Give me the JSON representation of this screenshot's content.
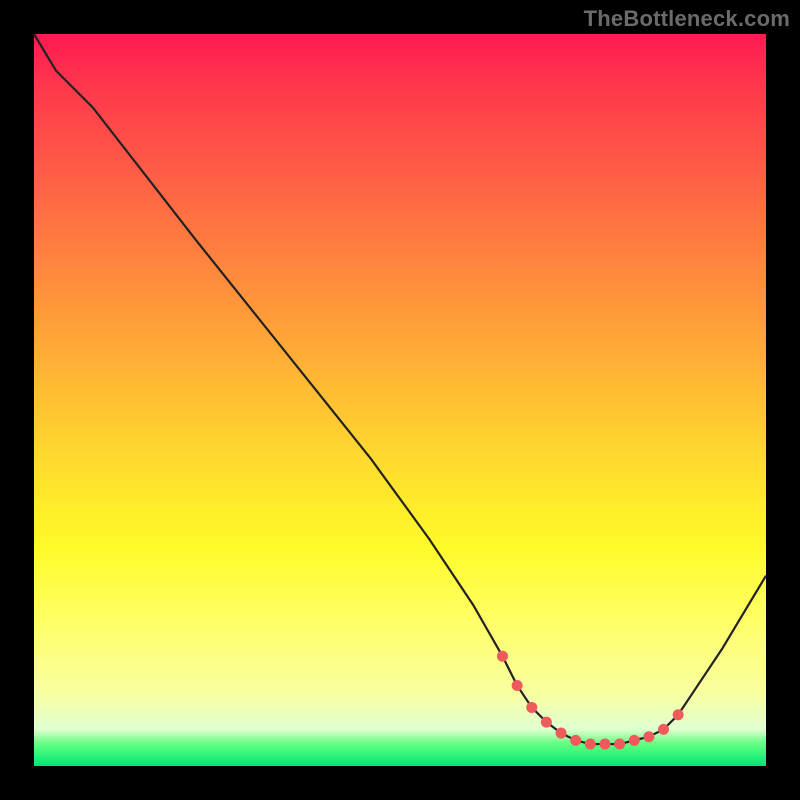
{
  "watermark": "TheBottleneck.com",
  "colors": {
    "background": "#000000",
    "curve": "#222222",
    "dot": "#ef5b5b",
    "gradient_top": "#ff1a52",
    "gradient_bottom": "#00e676"
  },
  "chart_data": {
    "type": "line",
    "title": "",
    "xlabel": "",
    "ylabel": "",
    "xlim": [
      0,
      100
    ],
    "ylim": [
      0,
      100
    ],
    "series": [
      {
        "name": "bottleneck-curve",
        "x": [
          0,
          3,
          8,
          15,
          22,
          30,
          38,
          46,
          54,
          60,
          64,
          66,
          68,
          70,
          72,
          74,
          76,
          78,
          80,
          82,
          84,
          86,
          88,
          90,
          94,
          100
        ],
        "y": [
          100,
          95,
          90,
          81,
          72,
          62,
          52,
          42,
          31,
          22,
          15,
          11,
          8,
          6,
          4.5,
          3.5,
          3,
          3,
          3,
          3.5,
          4,
          5,
          7,
          10,
          16,
          26
        ]
      }
    ],
    "optimal_points": {
      "x": [
        64,
        66,
        68,
        70,
        72,
        74,
        76,
        78,
        80,
        82,
        84,
        86,
        88
      ],
      "y": [
        15,
        11,
        8,
        6,
        4.5,
        3.5,
        3,
        3,
        3,
        3.5,
        4,
        5,
        7
      ]
    }
  }
}
